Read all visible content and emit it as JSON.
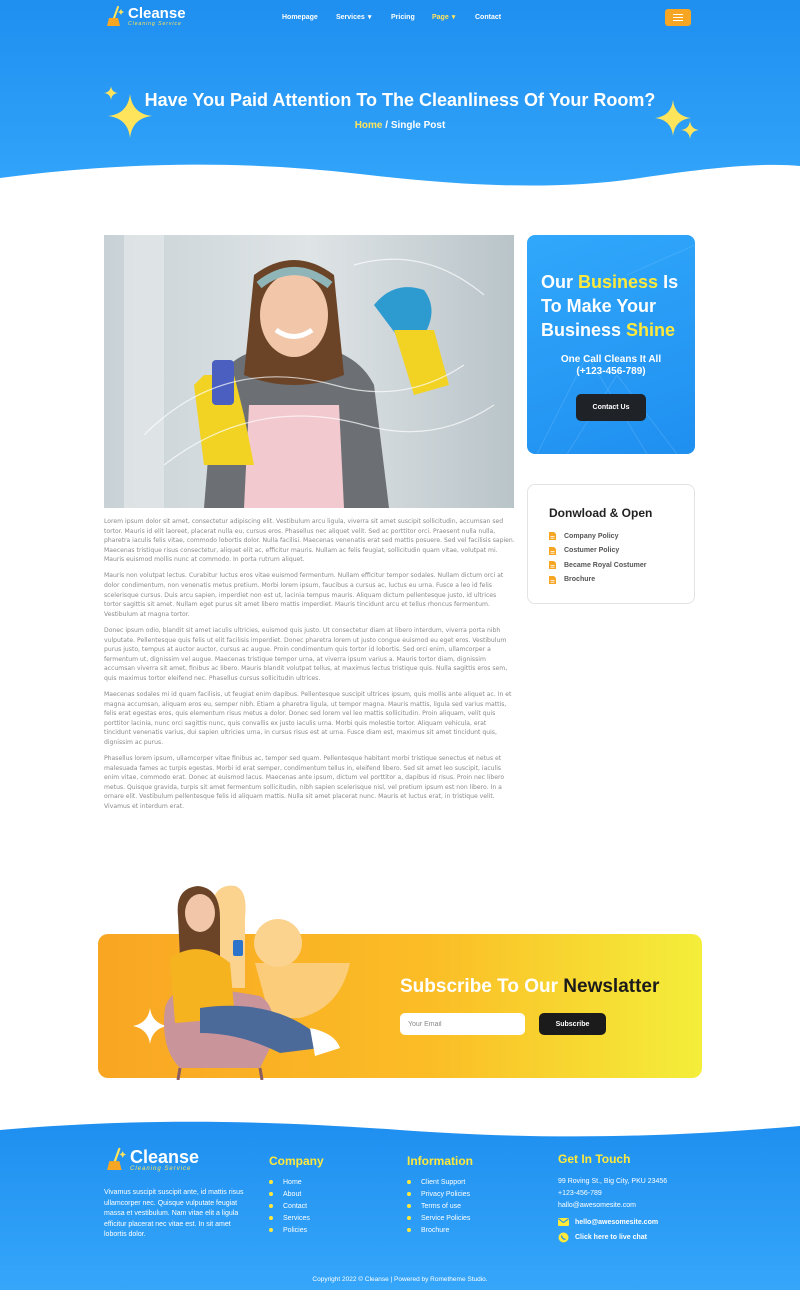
{
  "brand": {
    "name": "Cleanse",
    "tagline": "Cleaning Service"
  },
  "nav": {
    "items": [
      {
        "label": "Homepage"
      },
      {
        "label": "Services",
        "dropdown": true
      },
      {
        "label": "Pricing"
      },
      {
        "label": "Page",
        "dropdown": true,
        "active": true
      },
      {
        "label": "Contact"
      }
    ]
  },
  "hero": {
    "title": "Have You Paid Attention To The Cleanliness Of Your Room?",
    "breadcrumb_home": "Home",
    "breadcrumb_sep": " / ",
    "breadcrumb_current": "Single Post"
  },
  "article": {
    "paragraphs": [
      "Lorem ipsum dolor sit amet, consectetur adipiscing elit. Vestibulum arcu ligula, viverra sit amet suscipit sollicitudin, accumsan sed tortor. Mauris id elit laoreet, placerat nulla eu, cursus eros. Phasellus nec aliquet velit. Sed ac porttitor orci. Praesent nulla nulla, pharetra iaculis felis vitae, commodo lobortis dolor. Nulla facilisi. Maecenas venenatis erat sed mattis posuere. Sed vel facilisis sapien. Maecenas tristique risus consectetur, aliquet elit ac, efficitur mauris. Nullam ac felis feugiat, sollicitudin quam vitae, volutpat mi. Mauris euismod mollis nunc at commodo. In porta rutrum aliquet.",
      "Mauris non volutpat lectus. Curabitur luctus eros vitae euismod fermentum. Nullam efficitur tempor sodales. Nullam dictum orci at dolor condimentum, non venenatis metus pretium. Morbi lorem ipsum, faucibus a cursus ac, luctus eu urna. Fusce a leo id felis scelerisque cursus. Duis arcu sapien, imperdiet non est ut, lacinia tempus mauris. Aliquam dictum pellentesque justo, id ultrices tortor sagittis sit amet. Nullam eget purus sit amet libero mattis imperdiet. Mauris tincidunt arcu et tellus rhoncus fermentum. Vestibulum at magna tortor.",
      "Donec ipsum odio, blandit sit amet iaculis ultricies, euismod quis justo. Ut consectetur diam at libero interdum, viverra porta nibh vulputate. Pellentesque quis felis ut elit facilisis imperdiet. Donec pharetra lorem ut justo congue euismod eu eget eros. Vestibulum purus justo, tempus at auctor auctor, cursus ac augue. Proin condimentum quis tortor id lobortis. Sed orci enim, ullamcorper a fermentum ut, dignissim vel augue. Maecenas tristique tempor urna, at viverra ipsum varius a. Mauris tortor diam, dignissim accumsan viverra sit amet, finibus ac libero. Mauris blandit volutpat tellus, at maximus lectus tristique quis. Nulla sagittis eros sem, quis maximus tortor eleifend nec. Phasellus cursus sollicitudin ultrices.",
      "Maecenas sodales mi id quam facilisis, ut feugiat enim dapibus. Pellentesque suscipit ultrices ipsum, quis mollis ante aliquet ac. In et magna accumsan, aliquam eros eu, semper nibh. Etiam a pharetra ligula, ut tempor magna. Mauris mattis, ligula sed varius mattis, felis erat egestas eros, quis elementum risus metus a dolor. Donec sed lorem vel leo mattis sollicitudin. Proin aliquam, velit quis porttitor lacinia, nunc orci sagittis nunc, quis convallis ex justo iaculis urna. Morbi quis molestie tortor. Aliquam vehicula, erat tincidunt venenatis varius, dui sapien ultricies urna, in cursus risus est at urna. Fusce diam est, maximus sit amet tincidunt quis, dignissim ac purus.",
      "Phasellus lorem ipsum, ullamcorper vitae finibus ac, tempor sed quam. Pellentesque habitant morbi tristique senectus et netus et malesuada fames ac turpis egestas. Morbi id erat semper, condimentum tellus in, eleifend libero. Sed sit amet leo suscipit, iaculis enim vitae, commodo erat. Donec at euismod lacus. Maecenas ante ipsum, dictum vel porttitor a, dapibus id risus. Proin nec libero metus. Quisque gravida, turpis sit amet fermentum sollicitudin, nibh sapien scelerisque nisl, vel pretium ipsum est non libero. In a ornare elit. Vestibulum pellentesque felis id aliquam mattis. Nulla sit amet placerat nunc. Mauris et luctus erat, in tristique velit. Vivamus et interdum erat."
    ]
  },
  "promo": {
    "line1_a": "Our ",
    "line1_hl": "Business",
    "line1_b": " Is",
    "line2": "To Make Your",
    "line3_a": "Business ",
    "line3_hl": "Shine",
    "sub1": "One Call Cleans It All",
    "sub2": "(+123-456-789)",
    "button": "Contact Us"
  },
  "downloads": {
    "title": "Donwload & Open",
    "items": [
      "Company Policy",
      "Costumer Policy",
      "Became Royal Costumer",
      "Brochure"
    ]
  },
  "subscribe": {
    "title_a": "Subscribe To Our ",
    "title_b": "Newslatter",
    "placeholder": "Your Email",
    "button": "Subscribe"
  },
  "footer": {
    "about": "Vivamus suscipit suscipit ante, id mattis risus ullamcorper nec. Quisque vulputate feugiat massa et vestibulum. Nam vitae elit a ligula efficitur placerat nec vitae est. In sit amet lobortis dolor.",
    "company_title": "Company",
    "company_links": [
      "Home",
      "About",
      "Contact",
      "Services",
      "Policies"
    ],
    "info_title": "Information",
    "info_links": [
      "Client Support",
      "Privacy Policies",
      "Terms of use",
      "Service Policies",
      "Brochure"
    ],
    "contact_title": "Get In Touch",
    "address": "99 Roving St., Big City, PKU 23456",
    "phone": "+123-456-789",
    "email_plain": "hallo@awesomesite.com",
    "email_bold": "hello@awesomesite.com",
    "chat": "Click here to live chat",
    "copyright": "Copyright 2022 © Cleanse | Powered by Rometheme Studio."
  },
  "colors": {
    "primary": "#1f8ff0",
    "accent_yellow": "#ffe93b",
    "orange": "#f6a623",
    "dark": "#1b1b1b"
  }
}
